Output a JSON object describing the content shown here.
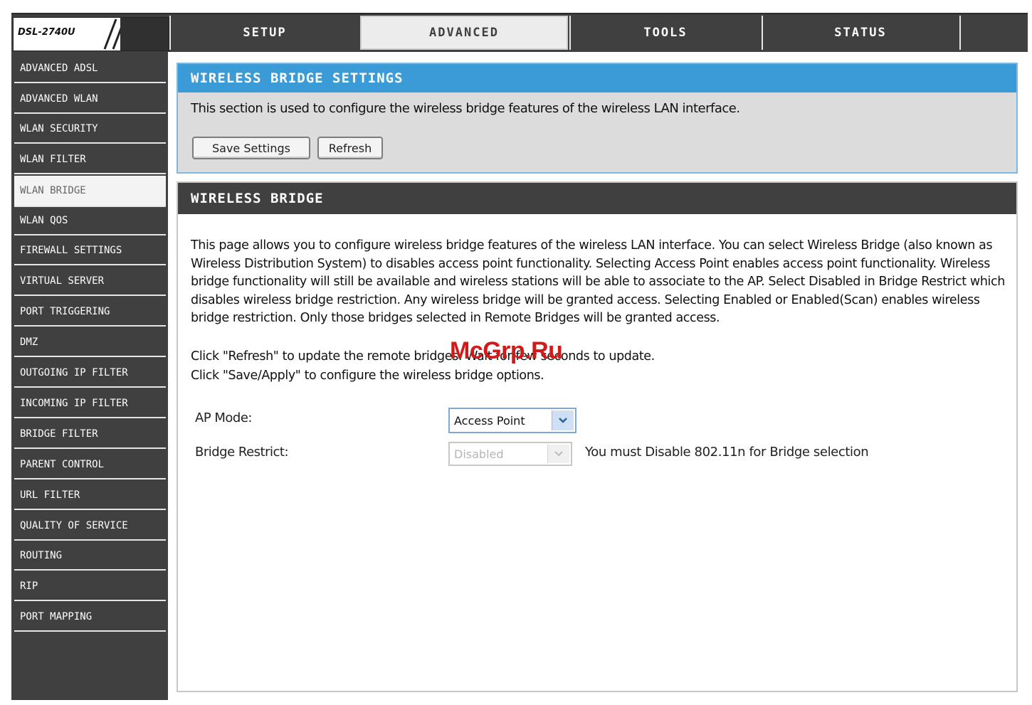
{
  "brand": {
    "model": "DSL-2740U"
  },
  "nav": {
    "tabs": [
      {
        "label": "SETUP"
      },
      {
        "label": "ADVANCED"
      },
      {
        "label": "TOOLS"
      },
      {
        "label": "STATUS"
      }
    ],
    "active": "ADVANCED"
  },
  "sidebar": {
    "items": [
      {
        "label": "ADVANCED ADSL"
      },
      {
        "label": "ADVANCED WLAN"
      },
      {
        "label": "WLAN SECURITY"
      },
      {
        "label": "WLAN FILTER"
      },
      {
        "label": "WLAN BRIDGE"
      },
      {
        "label": "WLAN QOS"
      },
      {
        "label": "FIREWALL SETTINGS"
      },
      {
        "label": "VIRTUAL SERVER"
      },
      {
        "label": "PORT TRIGGERING"
      },
      {
        "label": "DMZ"
      },
      {
        "label": "OUTGOING IP FILTER"
      },
      {
        "label": "INCOMING IP FILTER"
      },
      {
        "label": "BRIDGE FILTER"
      },
      {
        "label": "PARENT CONTROL"
      },
      {
        "label": "URL FILTER"
      },
      {
        "label": "QUALITY OF SERVICE"
      },
      {
        "label": "ROUTING"
      },
      {
        "label": "RIP"
      },
      {
        "label": "PORT MAPPING"
      }
    ],
    "active": "WLAN BRIDGE"
  },
  "settings": {
    "title": "WIRELESS BRIDGE SETTINGS",
    "description": "This section is used to configure the wireless bridge features of the wireless LAN interface.",
    "save_label": "Save Settings",
    "refresh_label": "Refresh"
  },
  "bridge": {
    "title": "WIRELESS BRIDGE",
    "paragraph": "This page allows you to configure wireless bridge features of the wireless LAN interface. You can select Wireless Bridge (also known as Wireless Distribution System) to disables access point functionality. Selecting Access Point enables access point functionality. Wireless bridge functionality will still be available and wireless stations will be able to associate to the AP. Select Disabled in Bridge Restrict which disables wireless bridge restriction. Any wireless bridge will be granted access. Selecting Enabled or Enabled(Scan) enables wireless bridge restriction. Only those bridges selected in Remote Bridges will be granted access.",
    "line_refresh": "Click \"Refresh\" to update the remote bridges. Wait for few seconds to update.",
    "line_save": "Click \"Save/Apply\" to configure the wireless bridge options.",
    "ap_mode_label": "AP Mode:",
    "ap_mode_value": "Access Point",
    "bridge_restrict_label": "Bridge Restrict:",
    "bridge_restrict_value": "Disabled",
    "bridge_restrict_note": "You must Disable 802.11n for Bridge selection"
  },
  "watermark": "McGrp.Ru"
}
